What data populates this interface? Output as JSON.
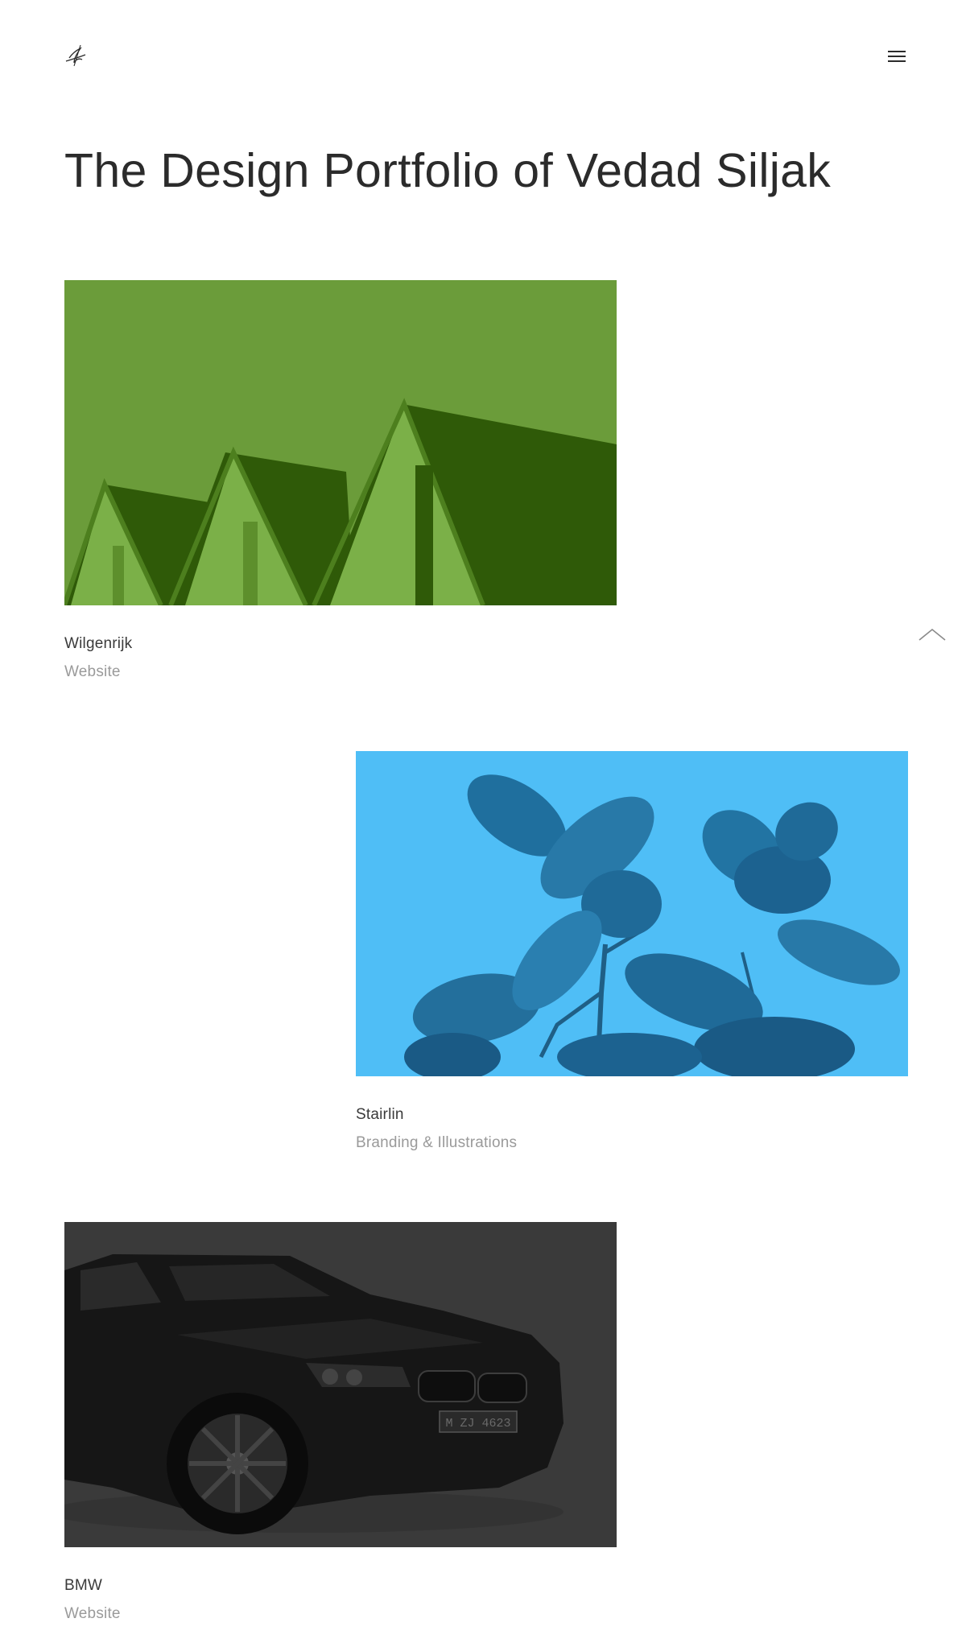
{
  "header": {
    "logo_icon": "signature-logo-icon",
    "menu_icon": "hamburger-menu-icon"
  },
  "page": {
    "title": "The Design Portfolio of Vedad Siljak"
  },
  "projects": [
    {
      "name": "Wilgenrijk",
      "category": "Website",
      "image": "green-tinted-rooftops",
      "tint": "#6b9c3a"
    },
    {
      "name": "Stairlin",
      "category": "Branding & Illustrations",
      "image": "blue-tinted-rubber-plant",
      "tint": "#4fbef6"
    },
    {
      "name": "BMW",
      "category": "Website",
      "image": "dark-black-bmw-car",
      "tint": "#3a3a3a"
    }
  ],
  "scroll_top_icon": "chevron-up-icon"
}
